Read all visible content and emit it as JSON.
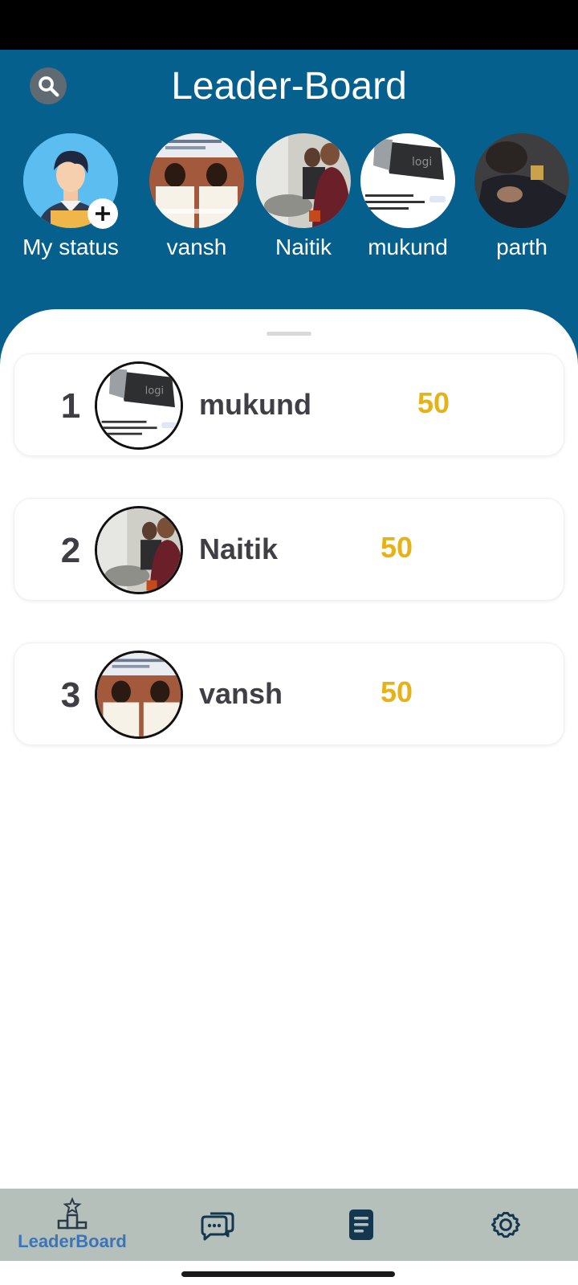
{
  "header": {
    "title": "Leader-Board"
  },
  "stories": [
    {
      "name": "My status",
      "avatar": "default-user-avatar"
    },
    {
      "name": "vansh",
      "avatar": "meme-photo"
    },
    {
      "name": "Naitik",
      "avatar": "kitchen-photo"
    },
    {
      "name": "mukund",
      "avatar": "logitech-receiver-photo"
    },
    {
      "name": "parth",
      "avatar": "dark-photo"
    }
  ],
  "leaderboard": [
    {
      "rank": "1",
      "name": "mukund",
      "score": "50"
    },
    {
      "rank": "2",
      "name": "Naitik",
      "score": "50"
    },
    {
      "rank": "3",
      "name": "vansh",
      "score": "50"
    }
  ],
  "nav": {
    "items": [
      {
        "label": "LeaderBoard",
        "icon": "podium-icon",
        "active": true
      },
      {
        "label": "",
        "icon": "chat-bubbles-icon",
        "active": false
      },
      {
        "label": "",
        "icon": "document-icon",
        "active": false
      },
      {
        "label": "",
        "icon": "gear-icon",
        "active": false
      }
    ]
  },
  "colors": {
    "header": "#05608e",
    "score": "#e6b21a",
    "nav": "#b6c0bb",
    "active_nav": "#3b74b8"
  }
}
